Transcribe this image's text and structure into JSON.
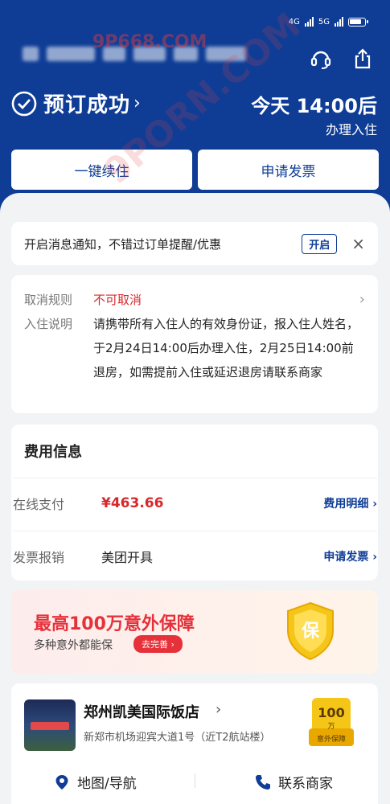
{
  "header": {
    "status_icons": [
      "signal-4g",
      "signal-5g",
      "battery"
    ],
    "status_4g": "4G",
    "status_5g": "5G",
    "title": "预订成功",
    "title_arrow": "›",
    "checkin_time": "今天 14:00后",
    "checkin_label": "办理入住",
    "btn_extend": "一键续住",
    "btn_invoice": "申请发票",
    "accent_color": "#0f3d96"
  },
  "notify": {
    "text": "开启消息通知，不错过订单提醒/优惠",
    "open_label": "开启",
    "close_label": "×"
  },
  "rules": {
    "cancel_key": "取消规则",
    "cancel_value": "不可取消",
    "checkin_key": "入住说明",
    "checkin_value": "请携带所有入住人的有效身份证，报入住人姓名，于2月24日14:00后办理入住，2月25日14:00前退房，如需提前入住或延迟退房请联系商家",
    "chevron": "›"
  },
  "fees": {
    "title": "费用信息",
    "pay_key": "在线支付",
    "pay_value": "¥463.66",
    "pay_link": "费用明细 ›",
    "invoice_key": "发票报销",
    "invoice_value": "美团开具",
    "invoice_link": "申请发票 ›"
  },
  "promo": {
    "headline": "最高100万意外保障",
    "sub": "多种意外都能保",
    "cta": "去完善 ›",
    "shield_char": "保"
  },
  "hotel": {
    "name": "郑州凯美国际饭店",
    "name_arrow": "›",
    "address": "新郑市机场迎宾大道1号（近T2航站楼）",
    "badge_amount": "100",
    "badge_unit": "万",
    "badge_caption": "意外保障",
    "action_map": "地图/导航",
    "action_contact": "联系商家"
  },
  "watermark": {
    "text_top": "9P668.COM",
    "text_diag": "9PORN.COM"
  }
}
